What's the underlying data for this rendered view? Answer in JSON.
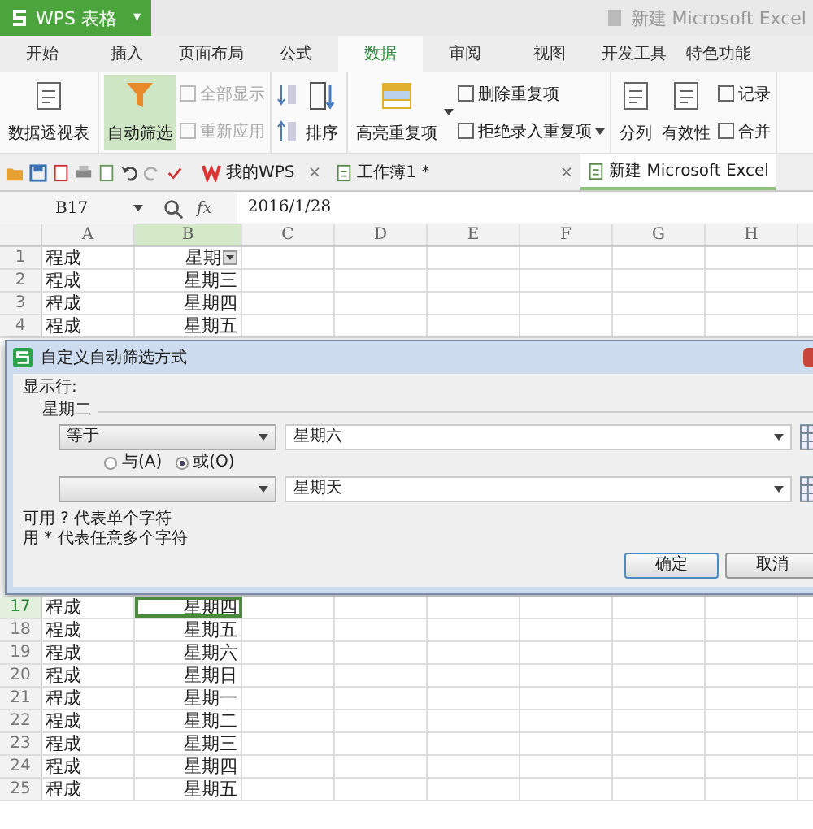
{
  "app": {
    "title": "WPS 表格",
    "menu_caret": "▾",
    "document_title": "新建 Microsoft Excel"
  },
  "tabs": [
    {
      "label": "开始",
      "selected": false
    },
    {
      "label": "插入",
      "selected": false
    },
    {
      "label": "页面布局",
      "selected": false
    },
    {
      "label": "公式",
      "selected": false
    },
    {
      "label": "数据",
      "selected": true
    },
    {
      "label": "审阅",
      "selected": false
    },
    {
      "label": "视图",
      "selected": false
    },
    {
      "label": "开发工具",
      "selected": false
    },
    {
      "label": "特色功能",
      "selected": false
    }
  ],
  "ribbon": {
    "groups": [
      {
        "items": [
          {
            "kind": "large",
            "label": "数据透视表",
            "selected": false,
            "disabled": false
          }
        ]
      },
      {
        "items": [
          {
            "kind": "large",
            "label": "自动筛选",
            "selected": true,
            "disabled": false
          },
          {
            "kind": "stack",
            "items": [
              {
                "label": "全部显示",
                "disabled": true
              },
              {
                "label": "重新应用",
                "disabled": true
              }
            ]
          }
        ]
      },
      {
        "items": [
          {
            "kind": "icons"
          },
          {
            "kind": "large",
            "label": "排序",
            "selected": false,
            "disabled": false
          }
        ]
      },
      {
        "items": [
          {
            "kind": "large",
            "label": "高亮重复项",
            "dropdown": true,
            "selected": false,
            "disabled": false
          },
          {
            "kind": "stack",
            "items": [
              {
                "label": "删除重复项",
                "disabled": false
              },
              {
                "label": "拒绝录入重复项",
                "dropdown": true,
                "disabled": false
              }
            ]
          }
        ]
      },
      {
        "items": [
          {
            "kind": "large",
            "label": "分列",
            "selected": false,
            "disabled": false
          },
          {
            "kind": "large",
            "label": "有效性",
            "selected": false,
            "disabled": false
          },
          {
            "kind": "stack",
            "items": [
              {
                "label": "记录",
                "disabled": false
              },
              {
                "label": "合并",
                "disabled": false
              }
            ]
          }
        ]
      }
    ]
  },
  "doc_tabs": [
    {
      "label": "我的WPS",
      "kind": "home",
      "close": "×",
      "selected": false
    },
    {
      "label": "工作簿1 *",
      "kind": "book",
      "close": "×",
      "selected": false
    },
    {
      "label": "新建 Microsoft Excel",
      "kind": "book",
      "selected": true
    }
  ],
  "formula_bar": {
    "cell": "B17",
    "fx": "fx",
    "value": "2016/1/28"
  },
  "columns": [
    {
      "label": "A",
      "selected": false
    },
    {
      "label": "B",
      "selected": true
    },
    {
      "label": "C",
      "selected": false
    },
    {
      "label": "D",
      "selected": false
    },
    {
      "label": "E",
      "selected": false
    },
    {
      "label": "F",
      "selected": false
    },
    {
      "label": "G",
      "selected": false
    },
    {
      "label": "H",
      "selected": false
    }
  ],
  "rows_top": [
    {
      "num": "1",
      "a": "程成",
      "b": "星期",
      "filter": true,
      "selected": false
    },
    {
      "num": "2",
      "a": "程成",
      "b": "星期三",
      "selected": false
    },
    {
      "num": "3",
      "a": "程成",
      "b": "星期四",
      "selected": false
    },
    {
      "num": "4",
      "a": "程成",
      "b": "星期五",
      "selected": false
    }
  ],
  "dialog": {
    "title": "自定义自动筛选方式",
    "show_rows_label": "显示行:",
    "field": "星期二",
    "conditions": [
      {
        "operator": "等于",
        "value": "星期六"
      },
      {
        "value": "星期天"
      }
    ],
    "logic": [
      {
        "label": "与(A)",
        "selected": false
      },
      {
        "label": "或(O)",
        "selected": true
      }
    ],
    "hints": [
      "可用 ? 代表单个字符",
      "用 * 代表任意多个字符"
    ],
    "buttons": [
      {
        "label": "确定",
        "default": true
      },
      {
        "label": "取消",
        "default": false
      }
    ]
  },
  "rows_bottom": [
    {
      "num": "17",
      "a": "程成",
      "b": "星期四",
      "selected": true
    },
    {
      "num": "18",
      "a": "程成",
      "b": "星期五",
      "selected": false
    },
    {
      "num": "19",
      "a": "程成",
      "b": "星期六",
      "selected": false
    },
    {
      "num": "20",
      "a": "程成",
      "b": "星期日",
      "selected": false
    },
    {
      "num": "21",
      "a": "程成",
      "b": "星期一",
      "selected": false
    },
    {
      "num": "22",
      "a": "程成",
      "b": "星期二",
      "selected": false
    },
    {
      "num": "23",
      "a": "程成",
      "b": "星期三",
      "selected": false
    },
    {
      "num": "24",
      "a": "程成",
      "b": "星期四",
      "selected": false
    },
    {
      "num": "25",
      "a": "程成",
      "b": "星期五",
      "selected": false
    }
  ]
}
